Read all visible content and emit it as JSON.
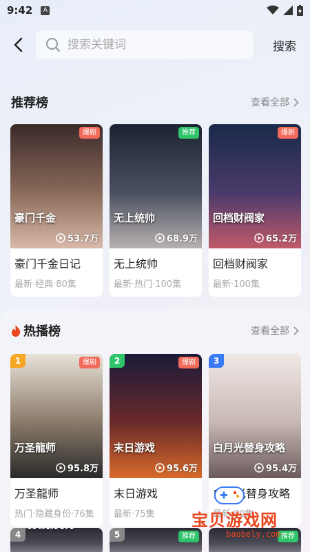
{
  "status_bar": {
    "time": "9:42",
    "notif": "A"
  },
  "search": {
    "placeholder": "搜索关键词",
    "button_label": "搜索"
  },
  "recommend": {
    "title": "推荐榜",
    "view_all": "查看全部",
    "cards": [
      {
        "title": "豪门千金日记",
        "meta": "最新·经典·80集",
        "plays": "53.7万",
        "badge": "爆剧",
        "badge_color": "#f26a5a",
        "poster_text": "豪门千金",
        "colors": [
          "#3b2a2a",
          "#8a6a5a",
          "#d8b8a8"
        ]
      },
      {
        "title": "无上统帅",
        "meta": "最新·热门·100集",
        "plays": "68.9万",
        "badge": "推荐",
        "badge_color": "#2fc46a",
        "poster_text": "无上统帅",
        "colors": [
          "#1c2330",
          "#4a5060",
          "#b8b0b0"
        ]
      },
      {
        "title": "回档财阀家",
        "meta": "最新·100集",
        "plays": "65.2万",
        "badge": "爆剧",
        "badge_color": "#f26a5a",
        "poster_text": "回档财阀家",
        "colors": [
          "#1a2a4a",
          "#4a3a6a",
          "#c05a6a"
        ]
      }
    ]
  },
  "hot": {
    "title": "热播榜",
    "view_all": "查看全部",
    "cards": [
      {
        "rank": "1",
        "rank_color": "#f5a623",
        "title": "万圣龍师",
        "meta": "热门·隐藏身份·76集",
        "plays": "95.8万",
        "badge": "爆剧",
        "badge_color": "#f26a5a",
        "poster_text": "万圣龍师",
        "colors": [
          "#e8e2d8",
          "#8a7a6a",
          "#2a2a2a"
        ]
      },
      {
        "rank": "2",
        "rank_color": "#2fc46a",
        "title": "末日游戏",
        "meta": "最新·75集",
        "plays": "95.6万",
        "badge": "爆剧",
        "badge_color": "#f26a5a",
        "poster_text": "末日游戏",
        "colors": [
          "#1a1a3a",
          "#6a2a2a",
          "#d86a2a"
        ]
      },
      {
        "rank": "3",
        "rank_color": "#3a7bf5",
        "title": "白月光替身攻略",
        "meta": "最新·80集",
        "plays": "95.4万",
        "badge": "",
        "badge_color": "",
        "poster_text": "白月光替身攻略",
        "colors": [
          "#f0e8e6",
          "#c8b8b4",
          "#6a5a5a"
        ]
      }
    ],
    "partial_cards": [
      {
        "rank": "4",
        "rank_color": "#888888",
        "badge": "",
        "poster_text": "DEEPING THIGEITA"
      },
      {
        "rank": "5",
        "rank_color": "#888888",
        "badge": "推荐",
        "poster_text": ""
      },
      {
        "rank": "",
        "rank_color": "",
        "badge": "推荐",
        "poster_text": ""
      }
    ]
  },
  "watermark": {
    "text": "宝贝游戏网",
    "url": "baobely.com"
  }
}
